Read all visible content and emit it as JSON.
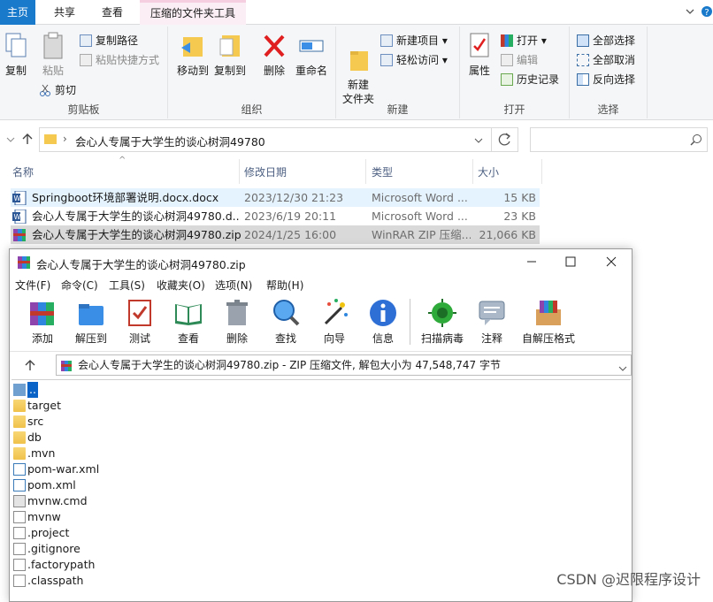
{
  "ribbon_tabs": [
    "主页",
    "共享",
    "查看",
    "压缩的文件夹工具"
  ],
  "ribbon": {
    "clipboard": {
      "label": "剪贴板",
      "copy": "复制",
      "paste": "粘贴",
      "copy_path": "复制路径",
      "paste_shortcut": "粘贴快捷方式",
      "cut": "剪切"
    },
    "organize": {
      "label": "组织",
      "move_to": "移动到",
      "copy_to": "复制到",
      "delete": "删除",
      "rename": "重命名"
    },
    "new": {
      "label": "新建",
      "new_item": "新建项目",
      "easy_access": "轻松访问",
      "new_folder": "新建\n文件夹"
    },
    "open": {
      "label": "打开",
      "properties": "属性",
      "open": "打开",
      "edit": "编辑",
      "history": "历史记录"
    },
    "select": {
      "label": "选择",
      "select_all": "全部选择",
      "select_none": "全部取消",
      "invert": "反向选择"
    }
  },
  "address": {
    "path": "会心人专属于大学生的谈心树洞49780",
    "search_placeholder": ""
  },
  "columns": {
    "name": "名称",
    "date": "修改日期",
    "type": "类型",
    "size": "大小"
  },
  "files": [
    {
      "name": "Springboot环境部署说明.docx.docx",
      "date": "2023/12/30 21:23",
      "type": "Microsoft Word ...",
      "size": "15 KB",
      "icon": "word-icon"
    },
    {
      "name": "会心人专属于大学生的谈心树洞49780.d...",
      "date": "2023/6/19 20:11",
      "type": "Microsoft Word ...",
      "size": "23 KB",
      "icon": "word-icon"
    },
    {
      "name": "会心人专属于大学生的谈心树洞49780.zip",
      "date": "2024/1/25 16:00",
      "type": "WinRAR ZIP 压缩...",
      "size": "21,066 KB",
      "icon": "winrar-icon"
    }
  ],
  "winrar": {
    "title": "会心人专属于大学生的谈心树洞49780.zip",
    "menu": [
      "文件(F)",
      "命令(C)",
      "工具(S)",
      "收藏夹(O)",
      "选项(N)",
      "帮助(H)"
    ],
    "toolbar": [
      "添加",
      "解压到",
      "测试",
      "查看",
      "删除",
      "查找",
      "向导",
      "信息",
      "扫描病毒",
      "注释",
      "自解压格式"
    ],
    "path": "会心人专属于大学生的谈心树洞49780.zip - ZIP 压缩文件, 解包大小为 47,548,747 字节",
    "items": [
      {
        "name": "..",
        "kind": "up"
      },
      {
        "name": "target",
        "kind": "folder"
      },
      {
        "name": "src",
        "kind": "folder"
      },
      {
        "name": "db",
        "kind": "folder"
      },
      {
        "name": ".mvn",
        "kind": "folder"
      },
      {
        "name": "pom-war.xml",
        "kind": "xml"
      },
      {
        "name": "pom.xml",
        "kind": "xml"
      },
      {
        "name": "mvnw.cmd",
        "kind": "cmd"
      },
      {
        "name": "mvnw",
        "kind": "file"
      },
      {
        "name": ".project",
        "kind": "file"
      },
      {
        "name": ".gitignore",
        "kind": "file"
      },
      {
        "name": ".factorypath",
        "kind": "file"
      },
      {
        "name": ".classpath",
        "kind": "file"
      }
    ]
  },
  "watermark": "CSDN @迟限程序设计",
  "colors": {
    "accent": "#1979ca",
    "selected_row": "#cce8ff",
    "ctx_tab": "#f5cfe0"
  }
}
